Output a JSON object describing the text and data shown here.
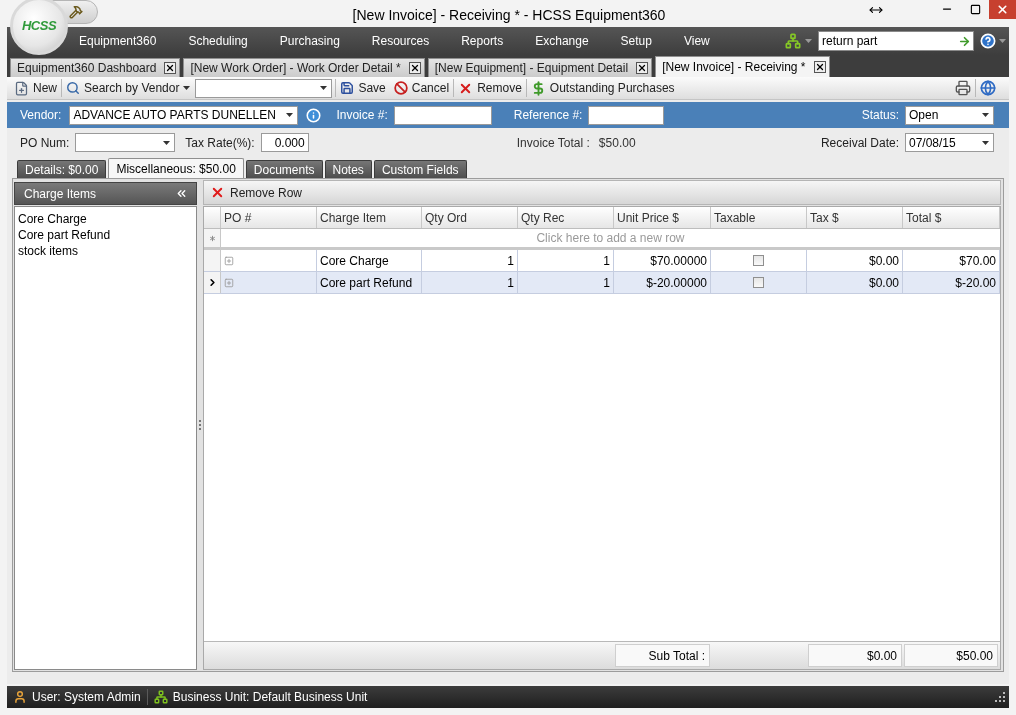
{
  "window": {
    "title": "[New Invoice] - Receiving * - HCSS Equipment360",
    "logo_text": "HCSS"
  },
  "menu": [
    "Equipment360",
    "Scheduling",
    "Purchasing",
    "Resources",
    "Reports",
    "Exchange",
    "Setup",
    "View"
  ],
  "search": {
    "value": "return part"
  },
  "document_tabs": [
    {
      "label": "Equipment360 Dashboard",
      "selected": false
    },
    {
      "label": "[New Work Order] - Work Order Detail *",
      "selected": false
    },
    {
      "label": "[New Equipment] - Equipment Detail",
      "selected": false
    },
    {
      "label": "[New Invoice] - Receiving *",
      "selected": true
    }
  ],
  "toolbar": {
    "new": "New",
    "search_by_vendor": "Search by Vendor",
    "save": "Save",
    "cancel": "Cancel",
    "remove": "Remove",
    "outstanding_purchases": "Outstanding Purchases"
  },
  "header_fields": {
    "vendor": {
      "label": "Vendor:",
      "value": "ADVANCE AUTO PARTS DUNELLEN"
    },
    "invoice_number": {
      "label": "Invoice #:"
    },
    "reference_number": {
      "label": "Reference #:"
    },
    "status": {
      "label": "Status:",
      "value": "Open"
    },
    "po_num": {
      "label": "PO Num:"
    },
    "tax_rate": {
      "label": "Tax Rate(%):",
      "value": "0.000"
    },
    "invoice_total": {
      "label": "Invoice Total :",
      "value": "$50.00"
    },
    "receival_date": {
      "label": "Receival Date:",
      "value": "07/08/15"
    }
  },
  "detail_tabs": [
    {
      "label": "Details: $0.00",
      "selected": false
    },
    {
      "label": "Miscellaneous: $50.00",
      "selected": true
    },
    {
      "label": "Documents",
      "selected": false
    },
    {
      "label": "Notes",
      "selected": false
    },
    {
      "label": "Custom Fields",
      "selected": false
    }
  ],
  "charge_items": {
    "title": "Charge Items",
    "items": [
      "Core Charge",
      "Core part Refund",
      "stock items"
    ]
  },
  "grid": {
    "remove_row": "Remove Row",
    "columns": [
      "PO #",
      "Charge Item",
      "Qty Ord",
      "Qty Rec",
      "Unit Price $",
      "Taxable",
      "Tax $",
      "Total $"
    ],
    "new_row_placeholder": "Click here to add a new row",
    "rows": [
      {
        "charge_item": "Core Charge",
        "qty_ord": "1",
        "qty_rec": "1",
        "unit_price": "$70.00000",
        "taxable": false,
        "tax": "$0.00",
        "total": "$70.00",
        "selected": false
      },
      {
        "charge_item": "Core part Refund",
        "qty_ord": "1",
        "qty_rec": "1",
        "unit_price": "$-20.00000",
        "taxable": false,
        "tax": "$0.00",
        "total": "$-20.00",
        "selected": true
      }
    ],
    "footer": {
      "label": "Sub Total :",
      "tax": "$0.00",
      "total": "$50.00"
    }
  },
  "status_bar": [
    {
      "kind": "user",
      "label": "User: System Admin"
    },
    {
      "kind": "business_unit",
      "label": "Business Unit: Default Business Unit"
    }
  ]
}
